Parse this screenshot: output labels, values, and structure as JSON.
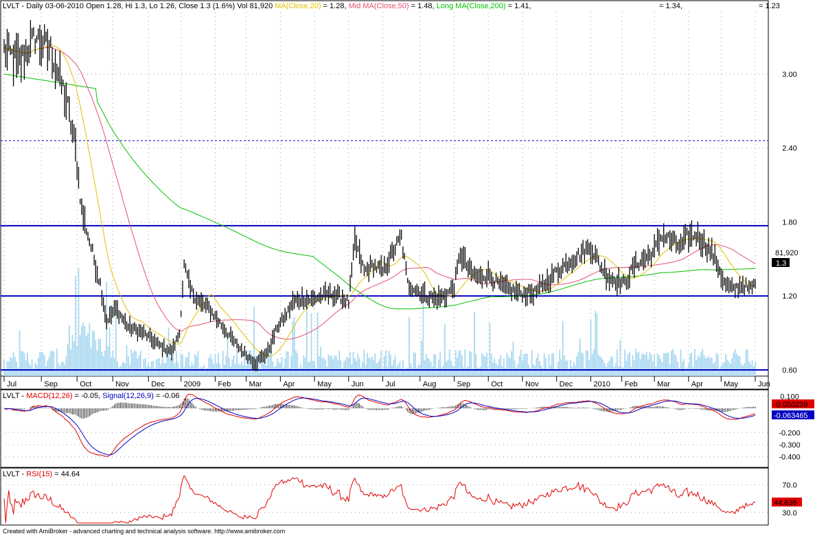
{
  "header": {
    "main": [
      {
        "text": "LVLT - Daily 03-06-2010 Open 1.28, Hi 1.3, Lo 1.26, Close 1.3 (1.6%) Vol 81,920 ",
        "color": "#000000"
      },
      {
        "text": "MA(Close,20)",
        "color": "#e0c000"
      },
      {
        "text": " = 1.28, ",
        "color": "#000000"
      },
      {
        "text": "Mid MA(Close,50)",
        "color": "#e05070"
      },
      {
        "text": " = 1.48, ",
        "color": "#000000"
      },
      {
        "text": "Long MA(Close,200)",
        "color": "#00c000"
      },
      {
        "text": " = 1.41,",
        "color": "#000000"
      }
    ],
    "extra1": "= 1.34,",
    "extra2": "= 1.23",
    "macd": [
      {
        "text": "LVLT - ",
        "color": "#000000"
      },
      {
        "text": "MACD(12,26)",
        "color": "#e00000"
      },
      {
        "text": " = -0.05, ",
        "color": "#000000"
      },
      {
        "text": "Signal(12,26,9)",
        "color": "#0000c0"
      },
      {
        "text": " = -0.06",
        "color": "#000000"
      }
    ],
    "rsi": [
      {
        "text": "LVLT - ",
        "color": "#000000"
      },
      {
        "text": "RSI(15)",
        "color": "#e00000"
      },
      {
        "text": " = 44.64",
        "color": "#000000"
      }
    ]
  },
  "footer": "Created with AmiBroker - advanced charting and technical analysis software. http://www.amibroker.com",
  "colors": {
    "price": "#000000",
    "ma20": "#e0c000",
    "ma50": "#e05070",
    "ma200": "#00c000",
    "volume": "#a8d8f0",
    "hline": "#0000c0",
    "macd": "#e00000",
    "signal": "#0000c0",
    "rsi": "#e00000"
  },
  "chart_data": [
    {
      "type": "line",
      "name": "price",
      "y_ticks": [
        0.6,
        1.2,
        1.8,
        2.4,
        3.0
      ],
      "y_tick_labels": [
        "0.60",
        "1.20",
        "1.80",
        "2.40",
        "3.00"
      ],
      "ylim": [
        0.55,
        3.5
      ],
      "x_tick_labels": [
        "Jul",
        "Sep",
        "Oct",
        "Nov",
        "Dec",
        "2009",
        "Feb",
        "Mar",
        "Apr",
        "May",
        "Jun",
        "Jul",
        "Aug",
        "Sep",
        "Oct",
        "Nov",
        "Dec",
        "2010",
        "Feb",
        "Mar",
        "Apr",
        "May",
        "Jun"
      ],
      "x_tick_bar_index": [
        0,
        24,
        47,
        70,
        93,
        114,
        136,
        156,
        178,
        200,
        222,
        244,
        268,
        290,
        312,
        334,
        356,
        378,
        398,
        419,
        441,
        462,
        484
      ],
      "close_keypoints": [
        [
          0,
          3.2
        ],
        [
          10,
          3.1
        ],
        [
          20,
          3.3
        ],
        [
          30,
          3.2
        ],
        [
          40,
          2.8
        ],
        [
          46,
          2.4
        ],
        [
          50,
          1.9
        ],
        [
          56,
          1.6
        ],
        [
          62,
          1.3
        ],
        [
          66,
          1.0
        ],
        [
          72,
          1.1
        ],
        [
          80,
          0.95
        ],
        [
          90,
          0.9
        ],
        [
          100,
          0.8
        ],
        [
          108,
          0.75
        ],
        [
          113,
          0.9
        ],
        [
          116,
          1.45
        ],
        [
          120,
          1.25
        ],
        [
          126,
          1.15
        ],
        [
          132,
          1.1
        ],
        [
          138,
          1.0
        ],
        [
          144,
          0.9
        ],
        [
          150,
          0.8
        ],
        [
          158,
          0.7
        ],
        [
          162,
          0.66
        ],
        [
          170,
          0.75
        ],
        [
          176,
          0.95
        ],
        [
          182,
          1.05
        ],
        [
          186,
          1.15
        ],
        [
          192,
          1.18
        ],
        [
          198,
          1.17
        ],
        [
          204,
          1.2
        ],
        [
          210,
          1.22
        ],
        [
          216,
          1.2
        ],
        [
          222,
          1.15
        ],
        [
          226,
          1.65
        ],
        [
          232,
          1.4
        ],
        [
          238,
          1.45
        ],
        [
          244,
          1.4
        ],
        [
          250,
          1.55
        ],
        [
          256,
          1.68
        ],
        [
          260,
          1.3
        ],
        [
          266,
          1.25
        ],
        [
          272,
          1.2
        ],
        [
          278,
          1.18
        ],
        [
          284,
          1.2
        ],
        [
          290,
          1.28
        ],
        [
          294,
          1.55
        ],
        [
          300,
          1.4
        ],
        [
          306,
          1.35
        ],
        [
          312,
          1.38
        ],
        [
          318,
          1.3
        ],
        [
          326,
          1.25
        ],
        [
          334,
          1.22
        ],
        [
          342,
          1.23
        ],
        [
          350,
          1.32
        ],
        [
          356,
          1.4
        ],
        [
          364,
          1.48
        ],
        [
          372,
          1.55
        ],
        [
          378,
          1.6
        ],
        [
          384,
          1.45
        ],
        [
          390,
          1.35
        ],
        [
          396,
          1.32
        ],
        [
          400,
          1.3
        ],
        [
          406,
          1.45
        ],
        [
          412,
          1.5
        ],
        [
          418,
          1.55
        ],
        [
          424,
          1.7
        ],
        [
          430,
          1.65
        ],
        [
          436,
          1.6
        ],
        [
          440,
          1.68
        ],
        [
          446,
          1.7
        ],
        [
          450,
          1.65
        ],
        [
          456,
          1.55
        ],
        [
          460,
          1.45
        ],
        [
          464,
          1.3
        ],
        [
          470,
          1.25
        ],
        [
          476,
          1.3
        ],
        [
          480,
          1.25
        ],
        [
          484,
          1.3
        ]
      ],
      "volume_max": 2.0,
      "horizontal_lines": [
        1.77,
        1.2,
        0.6
      ],
      "dashed_line": 2.46,
      "last_close_label": "1.3",
      "volume_label": "81,920",
      "ma20_last": 1.28,
      "ma50_last": 1.48,
      "ma200_last": 1.41
    },
    {
      "type": "line",
      "name": "macd",
      "y_ticks": [
        0.1,
        -0.2,
        -0.3,
        -0.4
      ],
      "y_tick_labels": [
        "0.100",
        "-0.200",
        "-0.300",
        "-0.400"
      ],
      "ylim": [
        -0.47,
        0.13
      ],
      "macd_label": "-0.050239",
      "signal_label": "-0.063465",
      "macd_last": -0.05,
      "signal_last": -0.06
    },
    {
      "type": "line",
      "name": "rsi",
      "y_ticks": [
        70.0,
        30.0
      ],
      "y_tick_labels": [
        "70.0",
        "30.0"
      ],
      "ylim": [
        15,
        90
      ],
      "rsi_label": "44.636",
      "rsi_last": 44.64
    }
  ]
}
